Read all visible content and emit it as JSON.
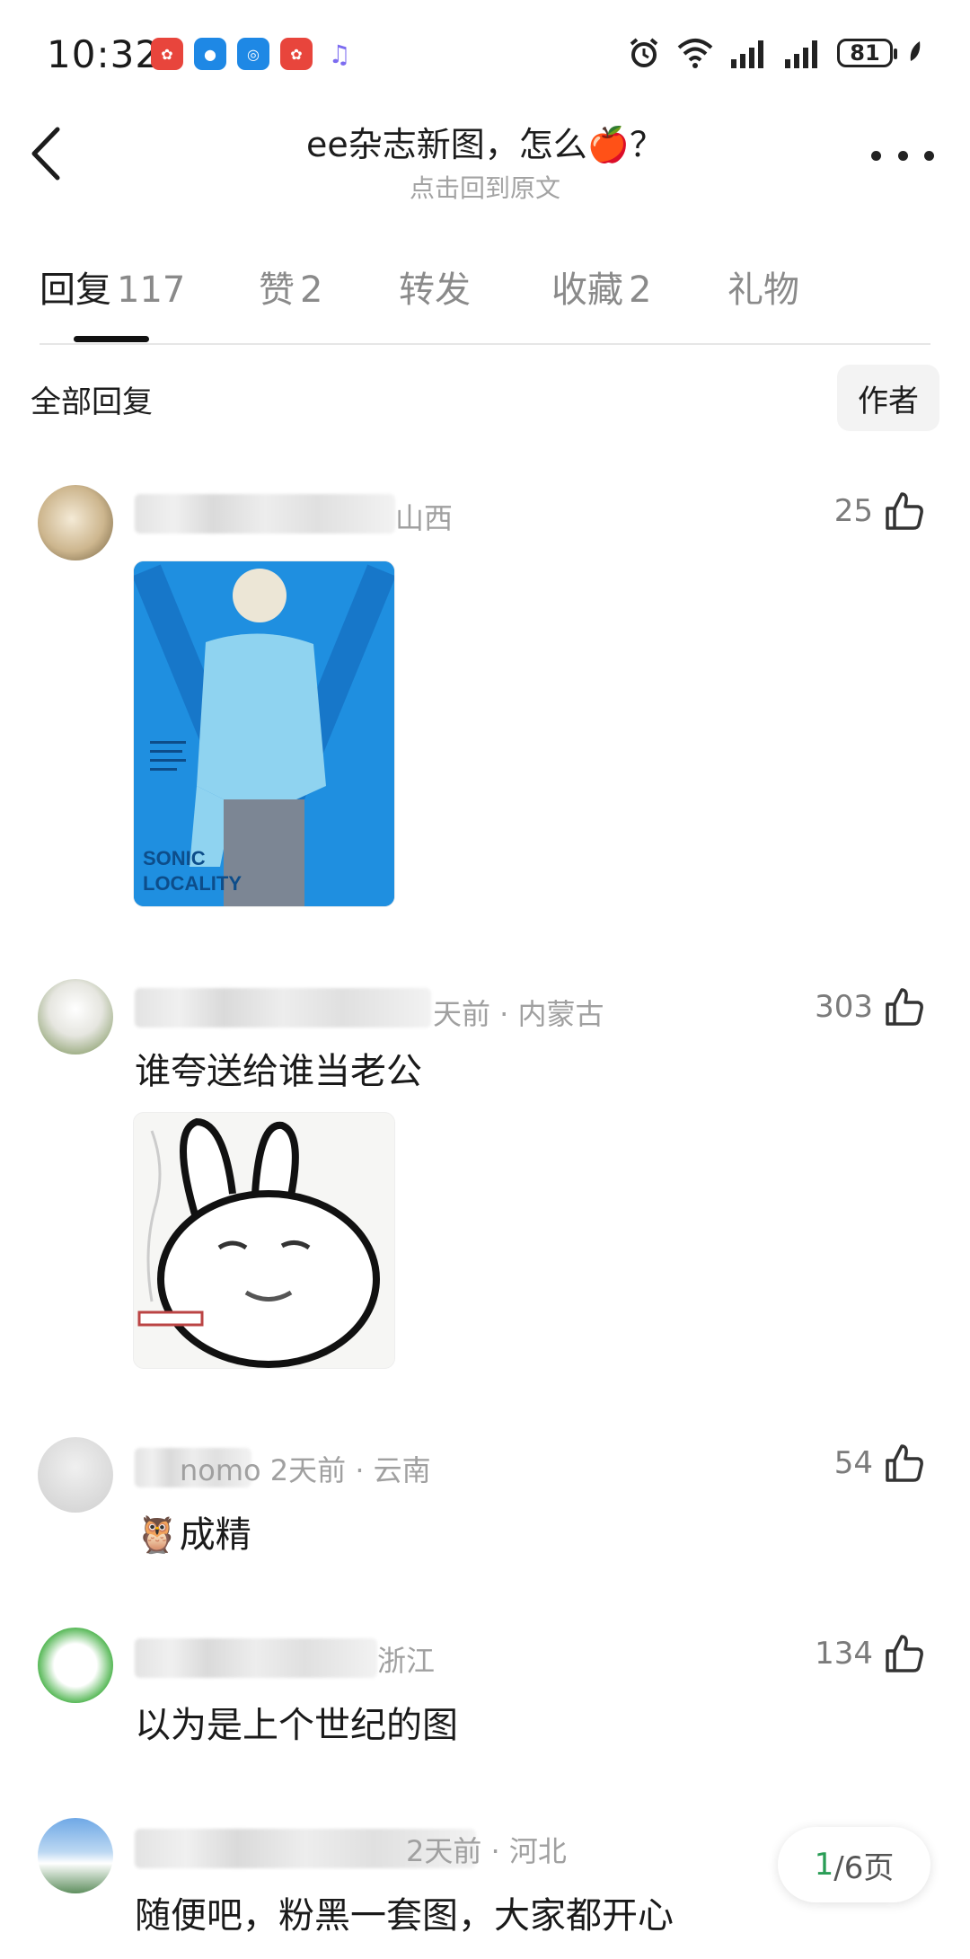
{
  "status_bar": {
    "time": "10:32",
    "battery": "81",
    "app_icons": [
      {
        "name": "app-icon-1",
        "color": "#e8453c"
      },
      {
        "name": "message-icon",
        "color": "#1e88e5"
      },
      {
        "name": "browser-icon",
        "color": "#1e88e5"
      },
      {
        "name": "app-icon-2",
        "color": "#e8453c"
      },
      {
        "name": "music-icon",
        "color": "#7c6cf0"
      }
    ]
  },
  "header": {
    "title": "ee杂志新图，怎么🍎？",
    "subtitle": "点击回到原文"
  },
  "tabs": [
    {
      "label": "回复",
      "count": "117",
      "active": true
    },
    {
      "label": "赞",
      "count": "2",
      "active": false
    },
    {
      "label": "转发",
      "count": "",
      "active": false
    },
    {
      "label": "收藏",
      "count": "2",
      "active": false
    },
    {
      "label": "礼物",
      "count": "",
      "active": false
    }
  ],
  "filter": {
    "label": "全部回复",
    "author_button": "作者"
  },
  "comments": [
    {
      "meta": "山西",
      "likes": "25",
      "text": "",
      "has_image": true,
      "image_text": "SONIC LOCALITY"
    },
    {
      "meta": "天前 · 内蒙古",
      "likes": "303",
      "text": "谁夸送给谁当老公",
      "has_image": true
    },
    {
      "meta": "nomo  2天前 · 云南",
      "likes": "54",
      "text": "🦉成精",
      "has_image": false
    },
    {
      "meta": "浙江",
      "likes": "134",
      "text": "以为是上个世纪的图",
      "has_image": false
    },
    {
      "meta": "2天前 · 河北",
      "likes": "",
      "text": "随便吧，粉黑一套图，大家都开心",
      "has_image": false
    }
  ],
  "pager": {
    "current": "1",
    "total": "/6页"
  },
  "colors": {
    "accent_green": "#2a9d56",
    "magazine_blue": "#1f8fe0"
  }
}
